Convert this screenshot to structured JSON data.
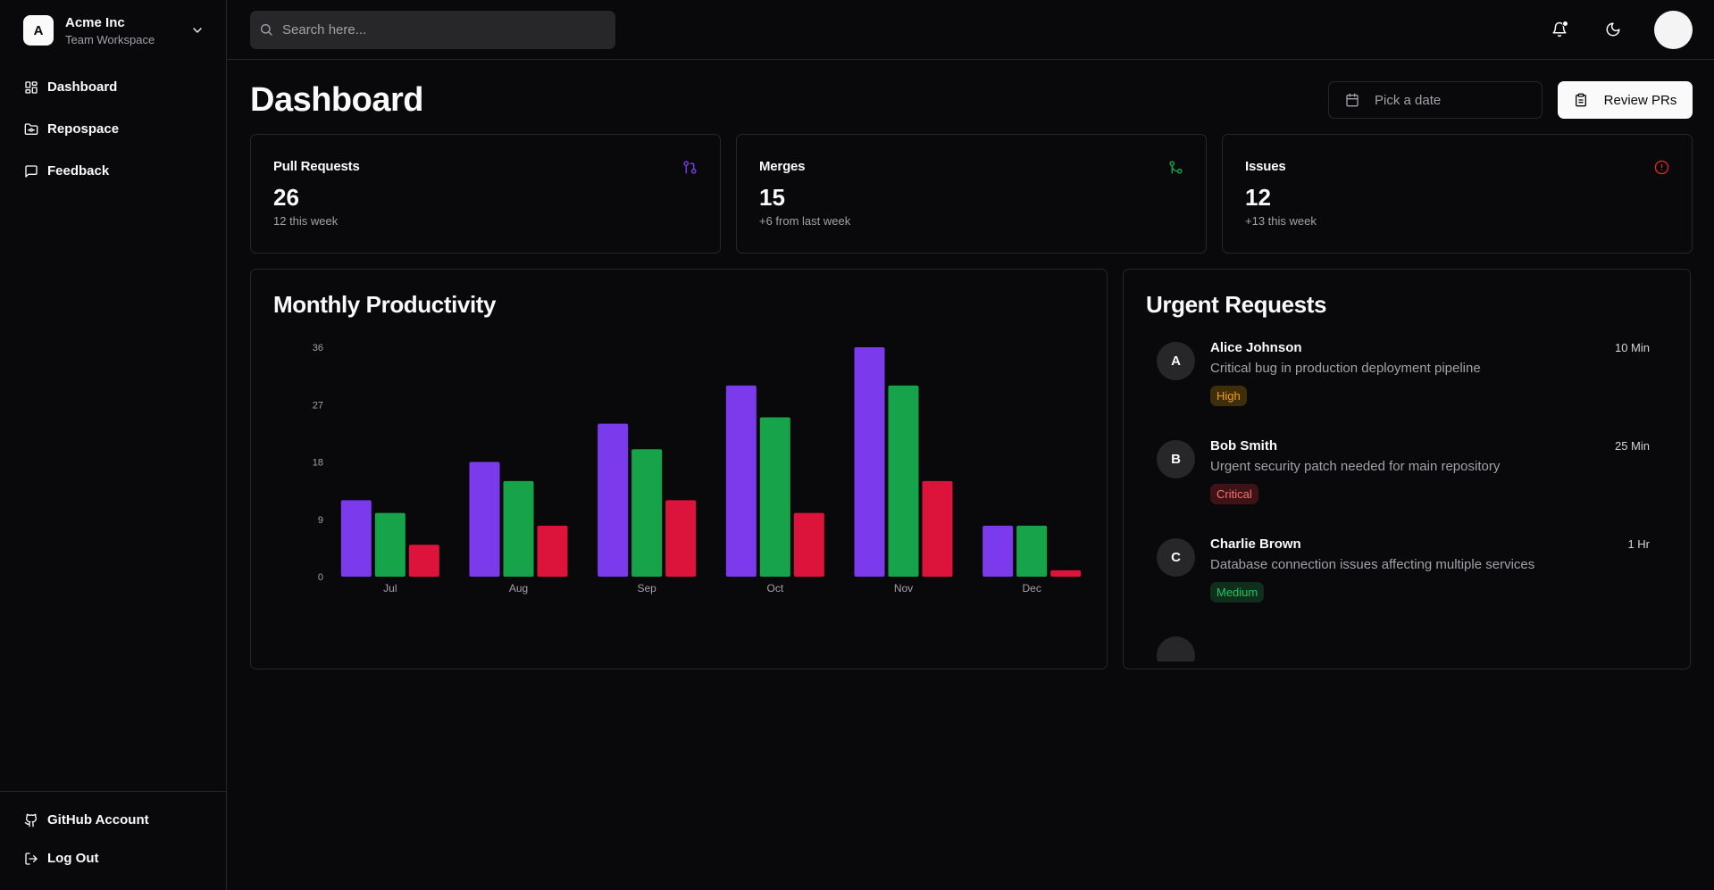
{
  "workspace": {
    "initial": "A",
    "name": "Acme Inc",
    "subtitle": "Team Workspace"
  },
  "sidebar": {
    "items": [
      {
        "label": "Dashboard",
        "icon": "layout-grid-icon"
      },
      {
        "label": "Repospace",
        "icon": "folder-git-icon"
      },
      {
        "label": "Feedback",
        "icon": "message-square-icon"
      }
    ],
    "footer": [
      {
        "label": "GitHub Account",
        "icon": "github-icon"
      },
      {
        "label": "Log Out",
        "icon": "log-out-icon"
      }
    ]
  },
  "search": {
    "placeholder": "Search here..."
  },
  "header": {
    "title": "Dashboard",
    "date_placeholder": "Pick a date",
    "review_label": "Review PRs"
  },
  "stats": [
    {
      "title": "Pull Requests",
      "value": "26",
      "sub": "12 this week",
      "icon": "git-pull-request-icon",
      "color": "#7c3aed"
    },
    {
      "title": "Merges",
      "value": "15",
      "sub": "+6 from last week",
      "icon": "git-merge-icon",
      "color": "#16a34a"
    },
    {
      "title": "Issues",
      "value": "12",
      "sub": "+13 this week",
      "icon": "alert-circle-icon",
      "color": "#dc2626"
    }
  ],
  "chart_card": {
    "title": "Monthly Productivity"
  },
  "chart_data": {
    "type": "bar",
    "categories": [
      "Jul",
      "Aug",
      "Sep",
      "Oct",
      "Nov",
      "Dec"
    ],
    "series": [
      {
        "values": [
          12,
          18,
          24,
          30,
          36,
          8
        ],
        "color": "#7c3aed"
      },
      {
        "values": [
          10,
          15,
          20,
          25,
          30,
          8
        ],
        "color": "#16a34a"
      },
      {
        "values": [
          5,
          8,
          12,
          10,
          15,
          1
        ],
        "color": "#dc143c"
      }
    ],
    "yticks": [
      0,
      9,
      18,
      27,
      36
    ],
    "ylim": [
      0,
      36
    ],
    "grid": false
  },
  "urgent": {
    "title": "Urgent Requests",
    "items": [
      {
        "initial": "A",
        "name": "Alice Johnson",
        "time": "10 Min",
        "message": "Critical bug in production deployment pipeline",
        "priority": "High",
        "badge_bg": "#3f2e0a",
        "badge_fg": "#f59e0b"
      },
      {
        "initial": "B",
        "name": "Bob Smith",
        "time": "25 Min",
        "message": "Urgent security patch needed for main repository",
        "priority": "Critical",
        "badge_bg": "#3f1216",
        "badge_fg": "#f87171"
      },
      {
        "initial": "C",
        "name": "Charlie Brown",
        "time": "1 Hr",
        "message": "Database connection issues affecting multiple services",
        "priority": "Medium",
        "badge_bg": "#0f2e1b",
        "badge_fg": "#22c55e"
      }
    ]
  }
}
